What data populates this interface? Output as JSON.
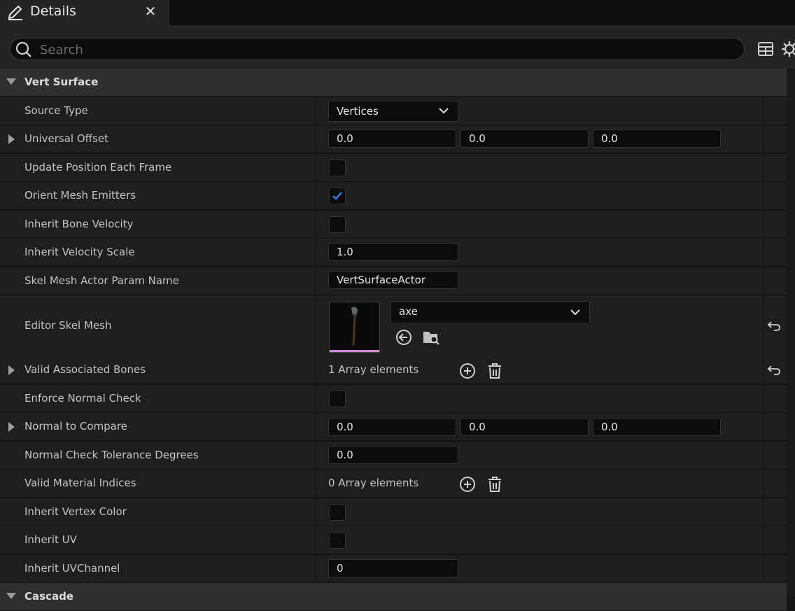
{
  "tab": {
    "title": "Details",
    "close": "✕"
  },
  "search": {
    "placeholder": "Search"
  },
  "sections": {
    "vert_surface": "Vert Surface",
    "cascade": "Cascade"
  },
  "rows": {
    "source_type": {
      "label": "Source Type",
      "value": "Vertices"
    },
    "universal_offset": {
      "label": "Universal Offset",
      "x": "0.0",
      "y": "0.0",
      "z": "0.0"
    },
    "update_position": {
      "label": "Update Position Each Frame",
      "checked": false
    },
    "orient_mesh": {
      "label": "Orient Mesh Emitters",
      "checked": true
    },
    "inherit_bone_velocity": {
      "label": "Inherit Bone Velocity",
      "checked": false
    },
    "inherit_velocity_scale": {
      "label": "Inherit Velocity Scale",
      "value": "1.0"
    },
    "skel_mesh_actor_param": {
      "label": "Skel Mesh Actor Param Name",
      "value": "VertSurfaceActor"
    },
    "editor_skel_mesh": {
      "label": "Editor Skel Mesh",
      "value": "axe"
    },
    "valid_associated_bones": {
      "label": "Valid Associated Bones",
      "value": "1 Array elements"
    },
    "enforce_normal_check": {
      "label": "Enforce Normal Check",
      "checked": false
    },
    "normal_to_compare": {
      "label": "Normal to Compare",
      "x": "0.0",
      "y": "0.0",
      "z": "0.0"
    },
    "normal_check_tolerance": {
      "label": "Normal Check Tolerance Degrees",
      "value": "0.0"
    },
    "valid_material_indices": {
      "label": "Valid Material Indices",
      "value": "0 Array elements"
    },
    "inherit_vertex_color": {
      "label": "Inherit Vertex Color",
      "checked": false
    },
    "inherit_uv": {
      "label": "Inherit UV",
      "checked": false
    },
    "inherit_uv_channel": {
      "label": "Inherit UVChannel",
      "value": "0"
    }
  },
  "colors": {
    "accent_check": "#2f7fe0",
    "thumbnail_bar": "#d48ad6"
  },
  "icons": [
    "edit-icon",
    "close-icon",
    "search-icon",
    "table-view-icon",
    "settings-icon",
    "chevron-down-icon",
    "expand-arrow-icon",
    "add-element-icon",
    "delete-icon",
    "reset-to-default-icon",
    "use-selected-asset-icon",
    "browse-asset-icon",
    "checkmark-icon"
  ]
}
